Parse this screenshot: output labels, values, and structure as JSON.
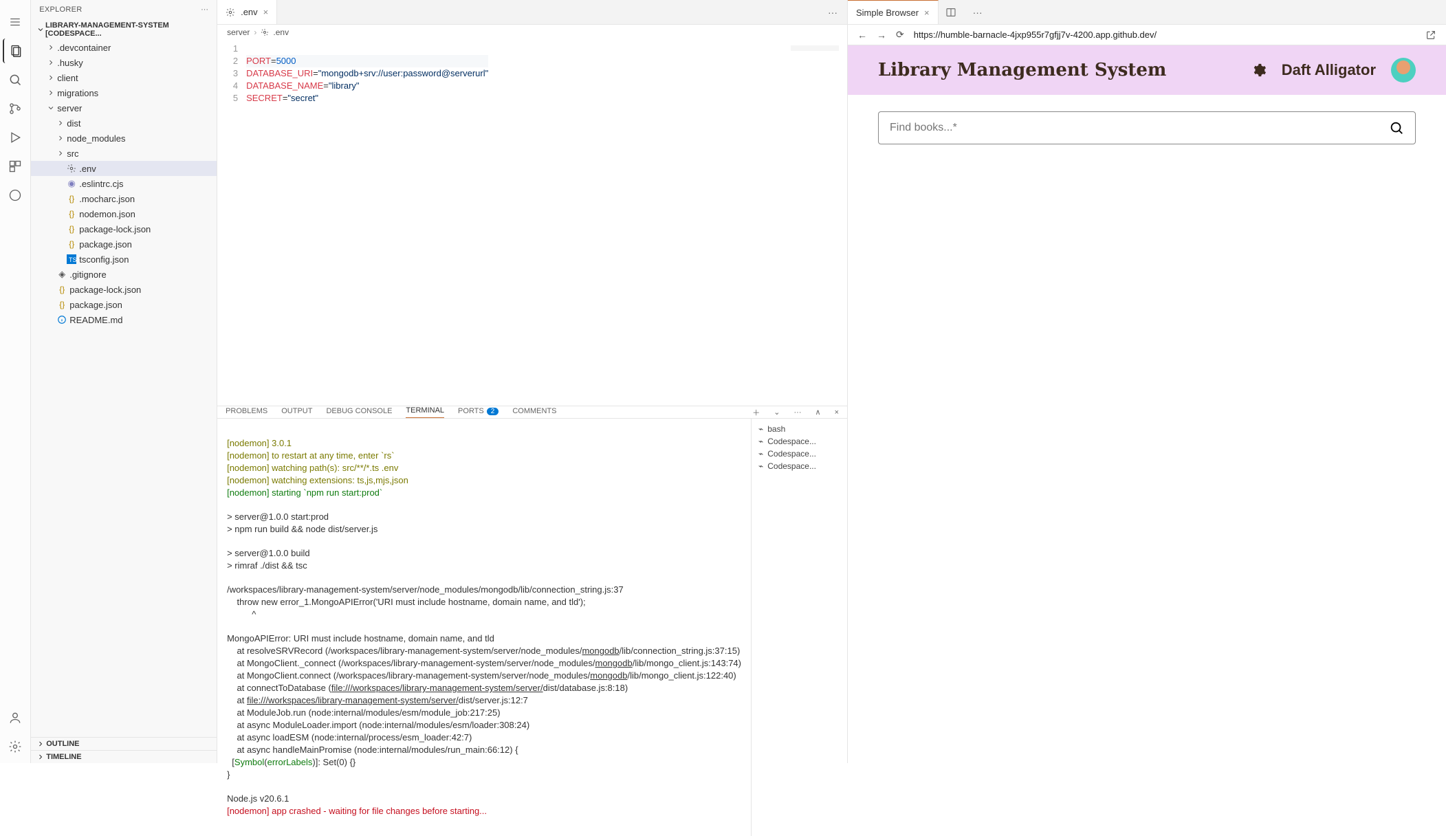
{
  "sidebar": {
    "title": "EXPLORER",
    "project": "LIBRARY-MANAGEMENT-SYSTEM [CODESPACE...",
    "tree": [
      {
        "name": ".devcontainer",
        "type": "folder",
        "depth": 1
      },
      {
        "name": ".husky",
        "type": "folder",
        "depth": 1
      },
      {
        "name": "client",
        "type": "folder",
        "depth": 1
      },
      {
        "name": "migrations",
        "type": "folder",
        "depth": 1
      },
      {
        "name": "server",
        "type": "folder",
        "depth": 1,
        "open": true
      },
      {
        "name": "dist",
        "type": "folder",
        "depth": 2
      },
      {
        "name": "node_modules",
        "type": "folder",
        "depth": 2
      },
      {
        "name": "src",
        "type": "folder",
        "depth": 2
      },
      {
        "name": ".env",
        "type": "file",
        "depth": 2,
        "icon": "gear",
        "selected": true
      },
      {
        "name": ".eslintrc.cjs",
        "type": "file",
        "depth": 2,
        "icon": "eslint"
      },
      {
        "name": ".mocharc.json",
        "type": "file",
        "depth": 2,
        "icon": "json"
      },
      {
        "name": "nodemon.json",
        "type": "file",
        "depth": 2,
        "icon": "json"
      },
      {
        "name": "package-lock.json",
        "type": "file",
        "depth": 2,
        "icon": "json"
      },
      {
        "name": "package.json",
        "type": "file",
        "depth": 2,
        "icon": "json"
      },
      {
        "name": "tsconfig.json",
        "type": "file",
        "depth": 2,
        "icon": "ts"
      },
      {
        "name": ".gitignore",
        "type": "file",
        "depth": 1,
        "icon": "git"
      },
      {
        "name": "package-lock.json",
        "type": "file",
        "depth": 1,
        "icon": "json"
      },
      {
        "name": "package.json",
        "type": "file",
        "depth": 1,
        "icon": "json"
      },
      {
        "name": "README.md",
        "type": "file",
        "depth": 1,
        "icon": "info"
      }
    ],
    "outline": "OUTLINE",
    "timeline": "TIMELINE"
  },
  "editor": {
    "tab_label": ".env",
    "breadcrumb1": "server",
    "breadcrumb2": ".env",
    "lines": [
      "1",
      "2",
      "3",
      "4",
      "5"
    ],
    "c1k": "PORT",
    "c1e": "=",
    "c1v": "5000",
    "c2k": "DATABASE_URI",
    "c2e": "=",
    "c2v": "\"mongodb+srv://user:password@serverurl\"",
    "c3k": "DATABASE_NAME",
    "c3e": "=",
    "c3v": "\"library\"",
    "c4k": "SECRET",
    "c4e": "=",
    "c4v": "\"secret\""
  },
  "panel": {
    "tabs": {
      "problems": "PROBLEMS",
      "output": "OUTPUT",
      "debug": "DEBUG CONSOLE",
      "terminal": "TERMINAL",
      "ports": "PORTS",
      "ports_badge": "2",
      "comments": "COMMENTS"
    },
    "terminal_sessions": [
      "bash",
      "Codespace...",
      "Codespace...",
      "Codespace..."
    ],
    "term": {
      "l1": "[nodemon] 3.0.1",
      "l2": "[nodemon] to restart at any time, enter `rs`",
      "l3": "[nodemon] watching path(s): src/**/*.ts .env",
      "l4": "[nodemon] watching extensions: ts,js,mjs,json",
      "l5": "[nodemon] starting `npm run start:prod`",
      "l6": "> server@1.0.0 start:prod",
      "l7": "> npm run build && node dist/server.js",
      "l8": "> server@1.0.0 build",
      "l9": "> rimraf ./dist && tsc",
      "l10": "/workspaces/library-management-system/server/node_modules/mongodb/lib/connection_string.js:37",
      "l11": "    throw new error_1.MongoAPIError('URI must include hostname, domain name, and tld');",
      "l12": "          ^",
      "l13": "MongoAPIError: URI must include hostname, domain name, and tld",
      "l14a": "    at resolveSRVRecord (/workspaces/library-management-system/server/",
      "l14b": "node_modules/",
      "l14c": "mongodb",
      "l14d": "/lib/connection_string.js:37:15",
      "l15a": "    at MongoClient._connect (/workspaces/library-management-system/server/",
      "l15b": "node_modules/",
      "l15c": "mongodb",
      "l15d": "/lib/mongo_client.js:143:74",
      "l16a": "    at MongoClient.connect (/workspaces/library-management-system/server/",
      "l16b": "node_modules/",
      "l16c": "mongodb",
      "l16d": "/lib/mongo_client.js:122:40",
      "l17a": "    at connectToDatabase (",
      "l17b": "file:///workspaces/library-management-system/server/",
      "l17c": "dist/database.js:8:18",
      "l18a": "    at ",
      "l18b": "file:///workspaces/library-management-system/server/",
      "l18c": "dist/server.js:12:7",
      "l19": "    at ModuleJob.run (node:internal/modules/esm/module_job:217:25)",
      "l20": "    at async ModuleLoader.import (node:internal/modules/esm/loader:308:24)",
      "l21": "    at async loadESM (node:internal/process/esm_loader:42:7)",
      "l22": "    at async handleMainPromise (node:internal/modules/run_main:66:12) {",
      "l23a": "  [",
      "l23b": "Symbol",
      "l23c": "(",
      "l23d": "errorLabels",
      "l23e": ")]: Set(0) {}",
      "l24": "}",
      "l25": "Node.js v20.6.1",
      "l26": "[nodemon] app crashed - waiting for file changes before starting..."
    }
  },
  "browser": {
    "tab": "Simple Browser",
    "url": "https://humble-barnacle-4jxp955r7gfjj7v-4200.app.github.dev/",
    "brand": "Library Management System",
    "username": "Daft Alligator",
    "search_placeholder": "Find books...*"
  }
}
